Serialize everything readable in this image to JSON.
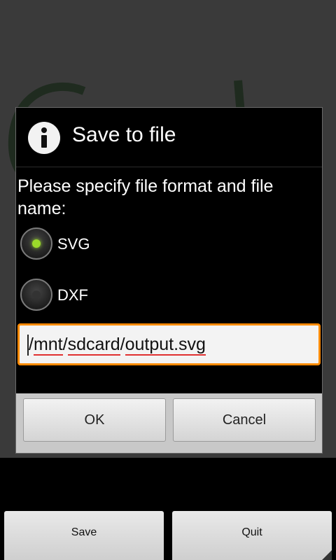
{
  "dialog": {
    "title": "Save to file",
    "icon": "info-icon",
    "message": "Please specify file format and file name:",
    "format_options": [
      {
        "label": "SVG",
        "selected": true
      },
      {
        "label": "DXF",
        "selected": false
      }
    ],
    "filename": {
      "value": "/mnt/sdcard/output.svg",
      "segments": [
        "/",
        "mnt",
        "/",
        "sdcard",
        "/",
        "output.svg"
      ]
    },
    "ok_label": "OK",
    "cancel_label": "Cancel",
    "accent_color": "#ff8a00",
    "radio_on_color": "#9bdc2a"
  },
  "bottom_bar": {
    "save_label": "Save",
    "quit_label": "Quit"
  }
}
